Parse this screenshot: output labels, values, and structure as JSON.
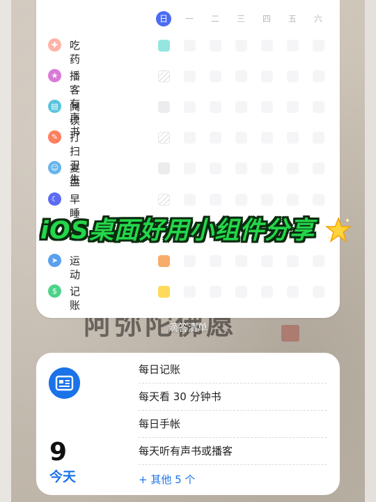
{
  "habits_widget": {
    "weekdays": [
      "日",
      "一",
      "二",
      "三",
      "四",
      "五",
      "六"
    ],
    "habits": [
      {
        "name": "吃药",
        "icon": "pill-icon",
        "icon_color": "#ffb3a6",
        "today_state": "done",
        "today_color": "#95e6e0"
      },
      {
        "name": "播客有声书",
        "icon": "star-icon",
        "icon_color": "#d97ad9",
        "today_state": "skipped"
      },
      {
        "name": "阅读",
        "icon": "book-icon",
        "icon_color": "#58c4dd",
        "today_state": "empty"
      },
      {
        "name": "打扫卫生",
        "icon": "broom-icon",
        "icon_color": "#ff7f5e",
        "today_state": "skipped"
      },
      {
        "name": "复盘",
        "icon": "face-icon",
        "icon_color": "#66b4ec",
        "today_state": "empty"
      },
      {
        "name": "早睡",
        "icon": "moon-icon",
        "icon_color": "#5b6cf2",
        "today_state": "skipped"
      },
      {
        "name": "运动",
        "icon": "runner-icon",
        "icon_color": "#5aa0f0",
        "today_state": "done",
        "today_color": "#f7ac6a"
      },
      {
        "name": "记账",
        "icon": "money-icon",
        "icon_color": "#4ed38a",
        "today_state": "done",
        "today_color": "#ffd95a"
      }
    ],
    "caption": "滴答清单"
  },
  "banner": {
    "text": "iOS桌面好用小组件分享",
    "icon": "sparkle-star-icon"
  },
  "background_text": "阿弥陀佛愿",
  "todo_widget": {
    "icon": "calendar-card-icon",
    "date_number": "9",
    "date_label": "今天",
    "items": [
      "每日记账",
      "每天看 30 分钟书",
      "每日手帐",
      "每天听有声书或播客"
    ],
    "more": "+ 其他 5 个"
  },
  "colors": {
    "accent_blue": "#1a73e8",
    "weekday_active": "#4b6cf2",
    "banner_green": "#24d64a"
  }
}
